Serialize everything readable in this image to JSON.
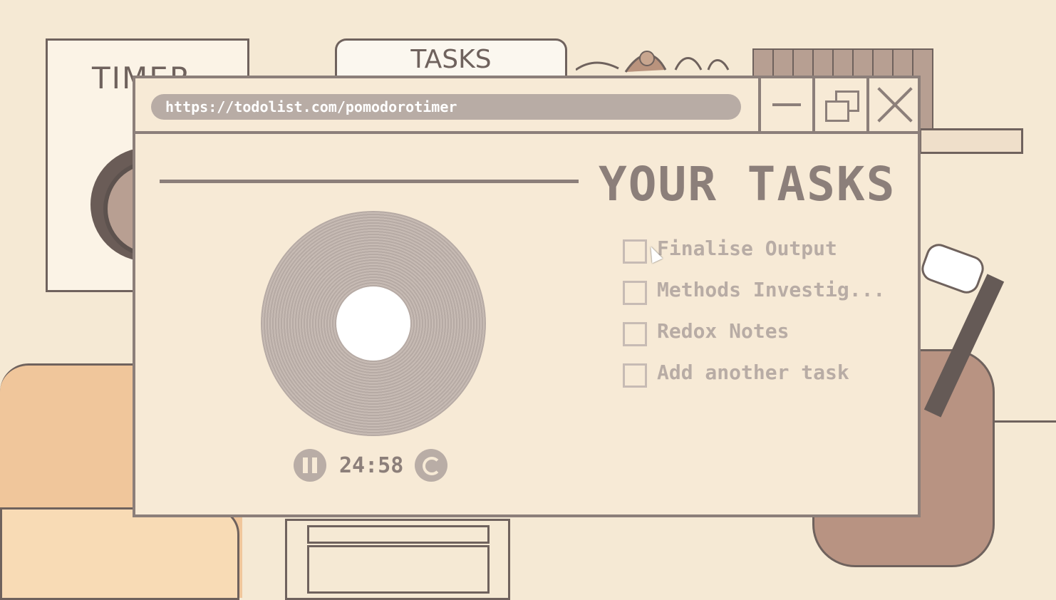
{
  "background": {
    "poster_text": "TIMER",
    "tab_label": "TASKS"
  },
  "window": {
    "url": "https://todolist.com/pomodorotimer",
    "title": "YOUR TASKS",
    "controls": {
      "minimize_icon": "minimize-icon",
      "maximize_icon": "restore-icon",
      "close_icon": "close-icon"
    }
  },
  "timer": {
    "time": "24:58",
    "pause_icon": "pause-icon",
    "reset_icon": "reset-icon"
  },
  "tasks": [
    {
      "label": "Finalise Output",
      "checked": false
    },
    {
      "label": "Methods Investig...",
      "checked": false
    },
    {
      "label": "Redox Notes",
      "checked": false
    },
    {
      "label": "Add another task",
      "checked": false
    }
  ],
  "colors": {
    "background": "#f5e9d4",
    "window": "#f7ead6",
    "accent": "#8c7f7a",
    "muted": "#b8aca5"
  }
}
